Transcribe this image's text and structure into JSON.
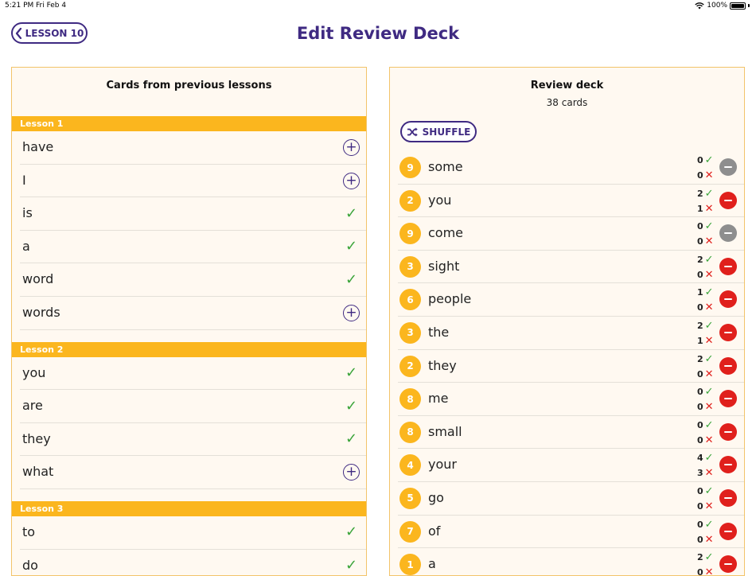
{
  "status_bar": {
    "time": "5:21 PM",
    "date": "Fri Feb 4",
    "battery": "100%"
  },
  "header": {
    "back_label": "LESSON 10",
    "title": "Edit Review Deck"
  },
  "left_panel": {
    "heading": "Cards from previous lessons",
    "lessons": [
      {
        "label": "Lesson 1",
        "words": [
          {
            "word": "have",
            "state": "add"
          },
          {
            "word": "I",
            "state": "add"
          },
          {
            "word": "is",
            "state": "added"
          },
          {
            "word": "a",
            "state": "added"
          },
          {
            "word": "word",
            "state": "added"
          },
          {
            "word": "words",
            "state": "add"
          }
        ]
      },
      {
        "label": "Lesson 2",
        "words": [
          {
            "word": "you",
            "state": "added"
          },
          {
            "word": "are",
            "state": "added"
          },
          {
            "word": "they",
            "state": "added"
          },
          {
            "word": "what",
            "state": "add"
          }
        ]
      },
      {
        "label": "Lesson 3",
        "words": [
          {
            "word": "to",
            "state": "added"
          },
          {
            "word": "do",
            "state": "added"
          }
        ]
      }
    ]
  },
  "right_panel": {
    "heading": "Review deck",
    "count_label": "38 cards",
    "shuffle_label": "SHUFFLE",
    "cards": [
      {
        "lesson": "9",
        "word": "some",
        "correct": "0",
        "wrong": "0",
        "removable": false
      },
      {
        "lesson": "2",
        "word": "you",
        "correct": "2",
        "wrong": "1",
        "removable": true
      },
      {
        "lesson": "9",
        "word": "come",
        "correct": "0",
        "wrong": "0",
        "removable": false
      },
      {
        "lesson": "3",
        "word": "sight",
        "correct": "2",
        "wrong": "0",
        "removable": true
      },
      {
        "lesson": "6",
        "word": "people",
        "correct": "1",
        "wrong": "0",
        "removable": true
      },
      {
        "lesson": "3",
        "word": "the",
        "correct": "2",
        "wrong": "1",
        "removable": true
      },
      {
        "lesson": "2",
        "word": "they",
        "correct": "2",
        "wrong": "0",
        "removable": true
      },
      {
        "lesson": "8",
        "word": "me",
        "correct": "0",
        "wrong": "0",
        "removable": true
      },
      {
        "lesson": "8",
        "word": "small",
        "correct": "0",
        "wrong": "0",
        "removable": true
      },
      {
        "lesson": "4",
        "word": "your",
        "correct": "4",
        "wrong": "3",
        "removable": true
      },
      {
        "lesson": "5",
        "word": "go",
        "correct": "0",
        "wrong": "0",
        "removable": true
      },
      {
        "lesson": "7",
        "word": "of",
        "correct": "0",
        "wrong": "0",
        "removable": true
      },
      {
        "lesson": "1",
        "word": "a",
        "correct": "2",
        "wrong": "0",
        "removable": true
      }
    ]
  },
  "colors": {
    "accent": "#3f2a82",
    "lesson_bar": "#fbb61e",
    "panel_bg": "#fff9f1",
    "check": "#3aa43a",
    "remove": "#e0201c",
    "disabled": "#8e8e8e"
  }
}
